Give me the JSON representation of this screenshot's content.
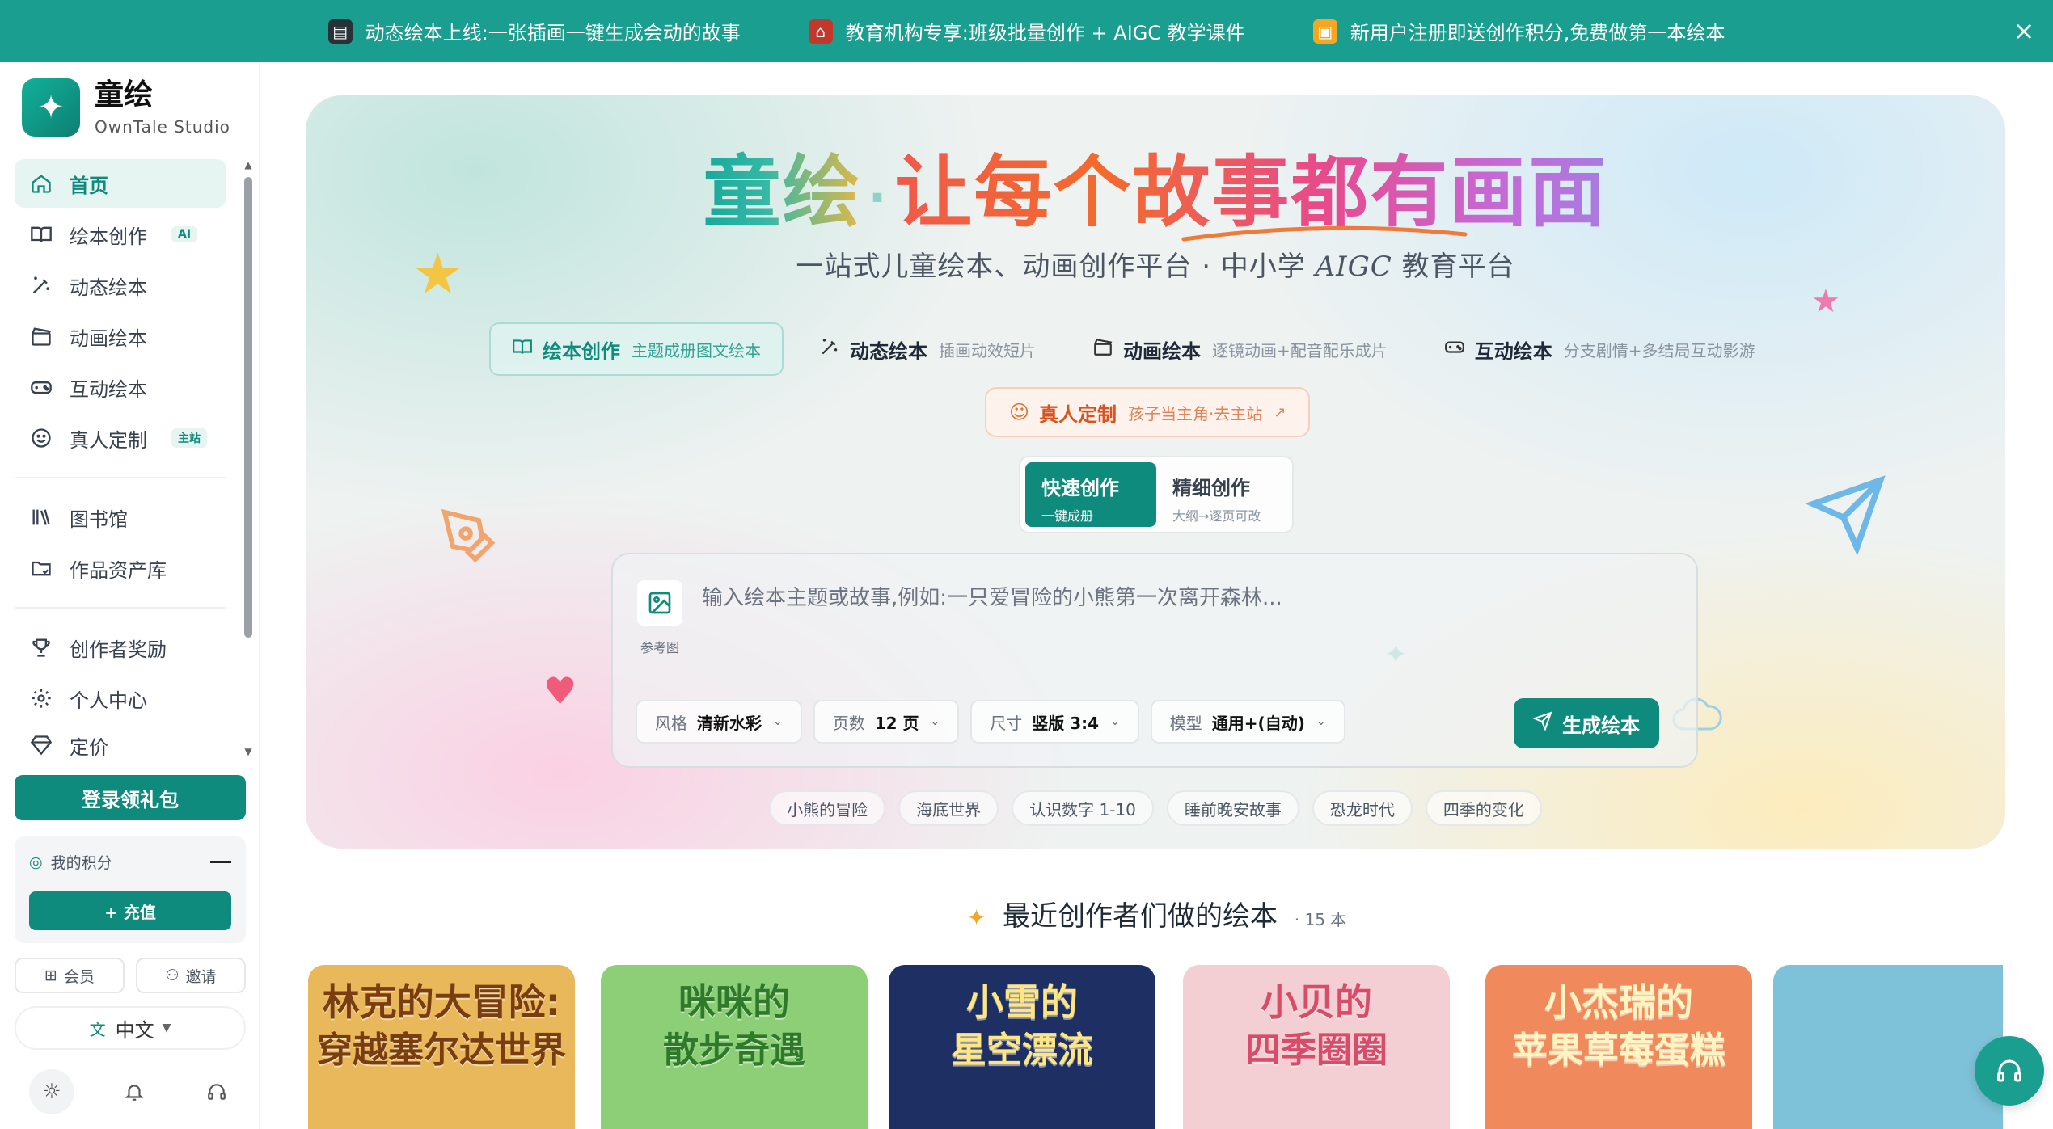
{
  "announcements": [
    {
      "icon": "clapperboard-icon",
      "glyph": "🎬",
      "text": "动态绘本上线:一张插画一键生成会动的故事"
    },
    {
      "icon": "school-icon",
      "glyph": "🏫",
      "text": "教育机构专享:班级批量创作 + AIGC 教学课件"
    },
    {
      "icon": "gift-icon",
      "glyph": "🎁",
      "text": "新用户注册即送创作积分,免费做第一本绘本"
    }
  ],
  "brand": {
    "name": "童绘",
    "subtitle": "OwnTale Studio"
  },
  "nav": {
    "primary": [
      {
        "label": "首页",
        "icon": "home-icon",
        "glyph": "⌂",
        "active": true,
        "tag": ""
      },
      {
        "label": "绘本创作",
        "icon": "book-open-icon",
        "glyph": "📖",
        "tag": "AI"
      },
      {
        "label": "动态绘本",
        "icon": "magic-wand-icon",
        "glyph": "✎",
        "tag": ""
      },
      {
        "label": "动画绘本",
        "icon": "clapperboard-icon",
        "glyph": "🎞",
        "tag": ""
      },
      {
        "label": "互动绘本",
        "icon": "gamepad-icon",
        "glyph": "🎮",
        "tag": ""
      },
      {
        "label": "真人定制",
        "icon": "smile-icon",
        "glyph": "☺",
        "tag": "主站"
      }
    ],
    "secondary": [
      {
        "label": "图书馆",
        "icon": "library-icon",
        "glyph": "▥"
      },
      {
        "label": "作品资产库",
        "icon": "folder-icon",
        "glyph": "🗀"
      }
    ],
    "tertiary": [
      {
        "label": "创作者奖励",
        "icon": "trophy-icon",
        "glyph": "🏆"
      },
      {
        "label": "个人中心",
        "icon": "gear-icon",
        "glyph": "⚙"
      },
      {
        "label": "定价",
        "icon": "diamond-icon",
        "glyph": "◇"
      }
    ]
  },
  "sidebar": {
    "login_label": "登录领礼包",
    "points_label": "我的积分",
    "recharge_label": "+ 充值",
    "member_label": "会员",
    "invite_label": "邀请",
    "language": "中文"
  },
  "hero": {
    "title_brand": "童绘",
    "title_dot": "·",
    "title_main": "让每个故事都有画面",
    "subtitle_a": "一站式儿童绘本、动画创作平台 · 中小学 ",
    "subtitle_aigc": "AIGC",
    "subtitle_b": " 教育平台",
    "modes": [
      {
        "label": "绘本创作",
        "desc": "主题成册图文绘本",
        "icon": "book-open-icon",
        "glyph": "📖",
        "active": true
      },
      {
        "label": "动态绘本",
        "desc": "插画动效短片",
        "icon": "magic-wand-icon",
        "glyph": "✎"
      },
      {
        "label": "动画绘本",
        "desc": "逐镜动画+配音配乐成片",
        "icon": "clapperboard-icon",
        "glyph": "🎞"
      },
      {
        "label": "互动绘本",
        "desc": "分支剧情+多结局互动影游",
        "icon": "gamepad-icon",
        "glyph": "🎮"
      }
    ],
    "custom": {
      "label": "真人定制",
      "desc": "孩子当主角·去主站"
    },
    "toggle": [
      {
        "label": "快速创作",
        "desc": "一键成册",
        "active": true
      },
      {
        "label": "精细创作",
        "desc": "大纲→逐页可改"
      }
    ],
    "ref_label": "参考图",
    "prompt_placeholder": "输入绘本主题或故事,例如:一只爱冒险的小熊第一次离开森林...",
    "options": [
      {
        "key": "风格",
        "value": "清新水彩"
      },
      {
        "key": "页数",
        "value": "12 页"
      },
      {
        "key": "尺寸",
        "value": "竖版 3:4"
      },
      {
        "key": "模型",
        "value": "通用+(自动)"
      }
    ],
    "generate_label": "生成绘本",
    "suggestions": [
      "小熊的冒险",
      "海底世界",
      "认识数字 1-10",
      "睡前晚安故事",
      "恐龙时代",
      "四季的变化"
    ]
  },
  "recent": {
    "title": "最近创作者们做的绘本",
    "count": "· 15 本",
    "cards": [
      {
        "title": "林克的大冒险:",
        "subtitle": "穿越塞尔达世界",
        "bg": "#e9b85a",
        "fg": "#7a3d12"
      },
      {
        "title": "咪咪的",
        "subtitle": "散步奇遇",
        "bg": "#8ccf76",
        "fg": "#2f7a2a"
      },
      {
        "title": "小雪的",
        "subtitle": "星空漂流",
        "bg": "#1d2f63",
        "fg": "#ffe680"
      },
      {
        "title": "小贝的",
        "subtitle": "四季圈圈",
        "bg": "#f3cfd3",
        "fg": "#d84c6a"
      },
      {
        "title": "小杰瑞的",
        "subtitle": "苹果草莓蛋糕",
        "bg": "#f08a5d",
        "fg": "#fff5c2"
      },
      {
        "title": "",
        "subtitle": "",
        "bg": "#7ec2d9",
        "fg": "#ffffff"
      }
    ]
  },
  "colors": {
    "brand": "#0f8b7d",
    "banner": "#1a9e8f"
  }
}
